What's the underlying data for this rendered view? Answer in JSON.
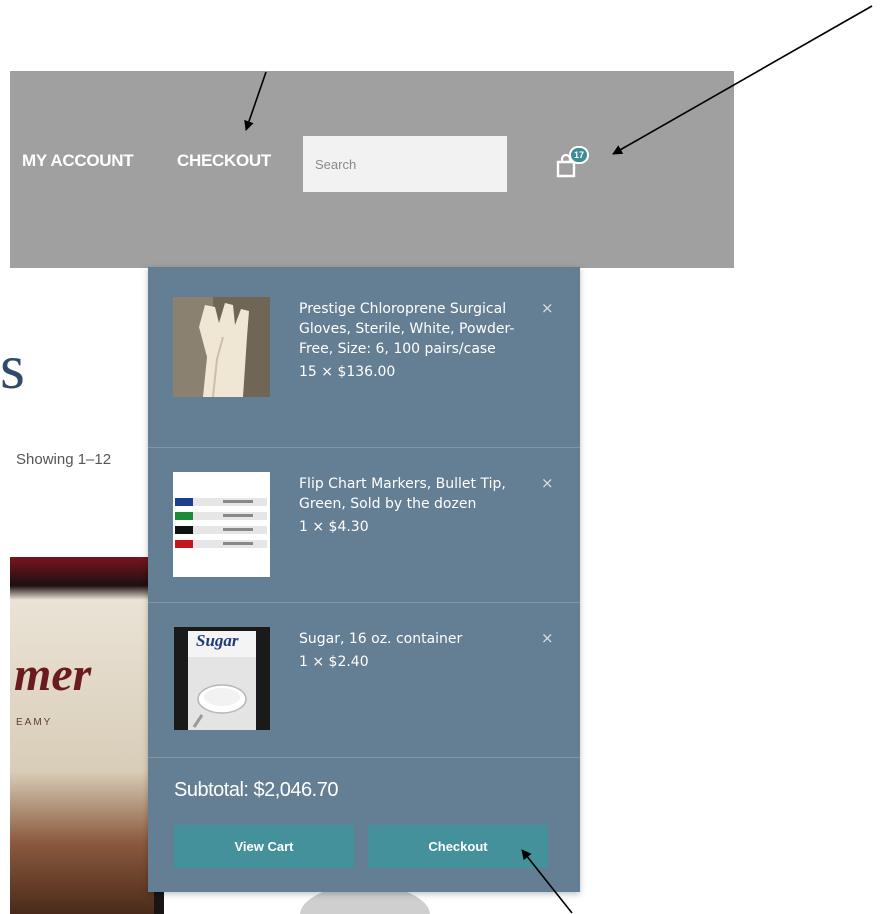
{
  "header": {
    "nav": {
      "my_account": "MY ACCOUNT",
      "checkout": "CHECKOUT"
    },
    "search": {
      "placeholder": "Search"
    },
    "cart": {
      "count": "17",
      "icon": "shopping-bag-icon"
    }
  },
  "background": {
    "heading_fragment": "s",
    "results_count": "Showing 1–12",
    "product_text": "mer",
    "product_subtext": "EAMY"
  },
  "mini_cart": {
    "items": [
      {
        "name": "Prestige Chloroprene Surgical Gloves, Sterile, White, Powder-Free, Size: 6, 100 pairs/case",
        "quantity_price": "15 × $136.00",
        "remove": "×",
        "thumb_icon": "glove-image"
      },
      {
        "name": "Flip Chart Markers, Bullet Tip, Green, Sold by the dozen",
        "quantity_price": "1 × $4.30",
        "remove": "×",
        "thumb_icon": "markers-image"
      },
      {
        "name": "Sugar, 16 oz. container",
        "quantity_price": "1 × $2.40",
        "remove": "×",
        "thumb_icon": "sugar-image",
        "thumb_label": "Sugar"
      }
    ],
    "subtotal": "Subtotal: $2,046.70",
    "view_cart_label": "View Cart",
    "checkout_label": "Checkout"
  },
  "colors": {
    "header_bg": "#a0a0a0",
    "mini_cart_bg": "#647f93",
    "button_bg": "#44909b",
    "badge_bg": "#3d8d96"
  }
}
